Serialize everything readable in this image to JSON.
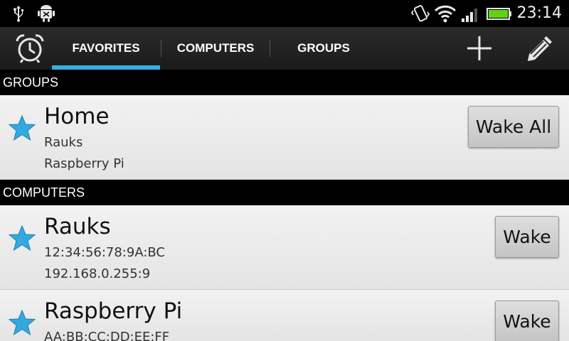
{
  "status_bar": {
    "time": "23:14",
    "icons": [
      "usb-icon",
      "android-debug-icon",
      "vibrate-icon",
      "wifi-icon",
      "signal-icon",
      "battery-icon"
    ],
    "battery_color": "#5fd316"
  },
  "action_bar": {
    "app_icon": "alarm-clock-icon",
    "tabs": [
      {
        "label": "FAVORITES",
        "active": true
      },
      {
        "label": "COMPUTERS",
        "active": false
      },
      {
        "label": "GROUPS",
        "active": false
      }
    ],
    "actions": [
      "add-icon",
      "edit-icon"
    ],
    "accent_color": "#33b1e6"
  },
  "sections": [
    {
      "header": "GROUPS",
      "items": [
        {
          "title": "Home",
          "lines": [
            "Rauks",
            "Raspberry Pi"
          ],
          "button": "Wake All",
          "favorite": true
        }
      ]
    },
    {
      "header": "COMPUTERS",
      "items": [
        {
          "title": "Rauks",
          "lines": [
            "12:34:56:78:9A:BC",
            "192.168.0.255:9"
          ],
          "button": "Wake",
          "favorite": true
        },
        {
          "title": "Raspberry Pi",
          "lines": [
            "AA:BB:CC:DD:EE:FF"
          ],
          "button": "Wake",
          "favorite": true
        }
      ]
    }
  ],
  "colors": {
    "star": "#33a9e0",
    "header_bg": "#000000"
  }
}
